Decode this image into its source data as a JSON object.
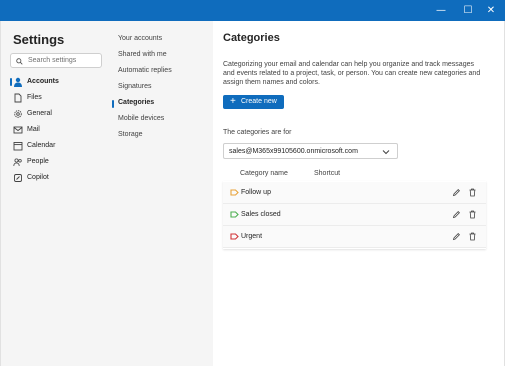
{
  "theme": {
    "accent": "#0f6cbd",
    "pane_bg": "#f5f5f5"
  },
  "window": {
    "minimize_glyph": "—",
    "maximize_glyph": "☐",
    "close_glyph": "✕"
  },
  "settings": {
    "title": "Settings",
    "search_placeholder": "Search settings",
    "nav": [
      {
        "label": "Accounts",
        "icon": "person-icon",
        "selected": true
      },
      {
        "label": "Files",
        "icon": "file-icon",
        "selected": false
      },
      {
        "label": "General",
        "icon": "gear-icon",
        "selected": false
      },
      {
        "label": "Mail",
        "icon": "mail-icon",
        "selected": false
      },
      {
        "label": "Calendar",
        "icon": "calendar-icon",
        "selected": false
      },
      {
        "label": "People",
        "icon": "people-icon",
        "selected": false
      },
      {
        "label": "Copilot",
        "icon": "copilot-icon",
        "selected": false
      }
    ]
  },
  "accounts_menu": {
    "items": [
      {
        "label": "Your accounts",
        "selected": false
      },
      {
        "label": "Shared with me",
        "selected": false
      },
      {
        "label": "Automatic replies",
        "selected": false
      },
      {
        "label": "Signatures",
        "selected": false
      },
      {
        "label": "Categories",
        "selected": true
      },
      {
        "label": "Mobile devices",
        "selected": false
      },
      {
        "label": "Storage",
        "selected": false
      }
    ]
  },
  "categories_page": {
    "heading": "Categories",
    "description": "Categorizing your email and calendar can help you organize and track messages and events related to a project, task, or person. You can create new categories and assign them names and colors.",
    "create_button": "Create new",
    "for_label": "The categories are for",
    "account_selected": "sales@M365x99105600.onmicrosoft.com",
    "columns": {
      "name": "Category name",
      "shortcut": "Shortcut"
    },
    "categories": [
      {
        "name": "Follow up",
        "color": "#e8a33a"
      },
      {
        "name": "Sales closed",
        "color": "#4caf50"
      },
      {
        "name": "Urgent",
        "color": "#d13438"
      }
    ]
  }
}
